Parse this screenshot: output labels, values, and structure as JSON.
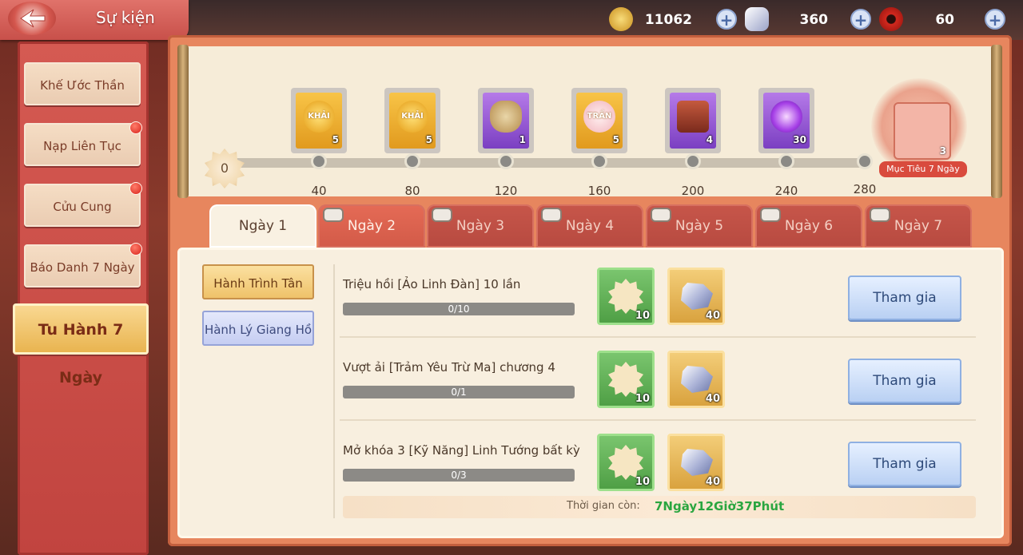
{
  "header": {
    "title": "Sự kiện",
    "resources": [
      {
        "icon": "coin-icon",
        "value": "11062",
        "color": "#e8b33a"
      },
      {
        "icon": "silver-ore-icon",
        "value": "360",
        "color": "#c9cde8"
      },
      {
        "icon": "red-jade-icon",
        "value": "60",
        "color": "#c8251c"
      }
    ]
  },
  "sidebar": {
    "items": [
      {
        "label": "Khế Ước Thần Linh",
        "dot": false
      },
      {
        "label": "Nạp Liên Tục",
        "dot": true
      },
      {
        "label": "Cửu Cung",
        "dot": true
      },
      {
        "label": "Báo Danh 7 Ngày",
        "dot": true
      },
      {
        "label": "Tu Hành 7 Ngày",
        "dot": false,
        "active": true
      }
    ]
  },
  "progress": {
    "start": "0",
    "milestones": [
      {
        "value": "40",
        "reward": "khai-orb",
        "reward_text": "KHẢI",
        "count": "5"
      },
      {
        "value": "80",
        "reward": "khai-orb",
        "reward_text": "KHẢI",
        "count": "5"
      },
      {
        "value": "120",
        "reward": "treasure-bag",
        "reward_text": "",
        "count": "1"
      },
      {
        "value": "160",
        "reward": "tran-orb",
        "reward_text": "TRẦN",
        "count": "5"
      },
      {
        "value": "200",
        "reward": "treasure-chest",
        "reward_text": "",
        "count": "4"
      },
      {
        "value": "240",
        "reward": "purple-crystal",
        "reward_text": "",
        "count": "30"
      }
    ],
    "final": {
      "value": "280",
      "count": "3",
      "label": "Mục Tiêu 7 Ngày"
    }
  },
  "tabs": [
    {
      "label": "Ngày 1",
      "locked": false
    },
    {
      "label": "Ngày 2",
      "locked": true
    },
    {
      "label": "Ngày 3",
      "locked": true
    },
    {
      "label": "Ngày 4",
      "locked": true
    },
    {
      "label": "Ngày 5",
      "locked": true
    },
    {
      "label": "Ngày 6",
      "locked": true
    },
    {
      "label": "Ngày 7",
      "locked": true
    }
  ],
  "categories": [
    "Hành Trình Tân Thủ",
    "Hành Lý Giang Hồ"
  ],
  "tasks": [
    {
      "name": "Triệu hồi [Ảo Linh Đàn] 10 lần",
      "progress": "0/10",
      "reward1": "10",
      "reward2": "40",
      "action": "Tham gia"
    },
    {
      "name": "Vượt ải [Trảm Yêu Trừ Ma] chương 4",
      "progress": "0/1",
      "reward1": "10",
      "reward2": "40",
      "action": "Tham gia"
    },
    {
      "name": "Mở khóa 3 [Kỹ Năng] Linh Tướng bất kỳ",
      "progress": "0/3",
      "reward1": "10",
      "reward2": "40",
      "action": "Tham gia"
    }
  ],
  "timer": {
    "label": "Thời gian còn:",
    "value": "7Ngày12Giờ37Phút"
  }
}
